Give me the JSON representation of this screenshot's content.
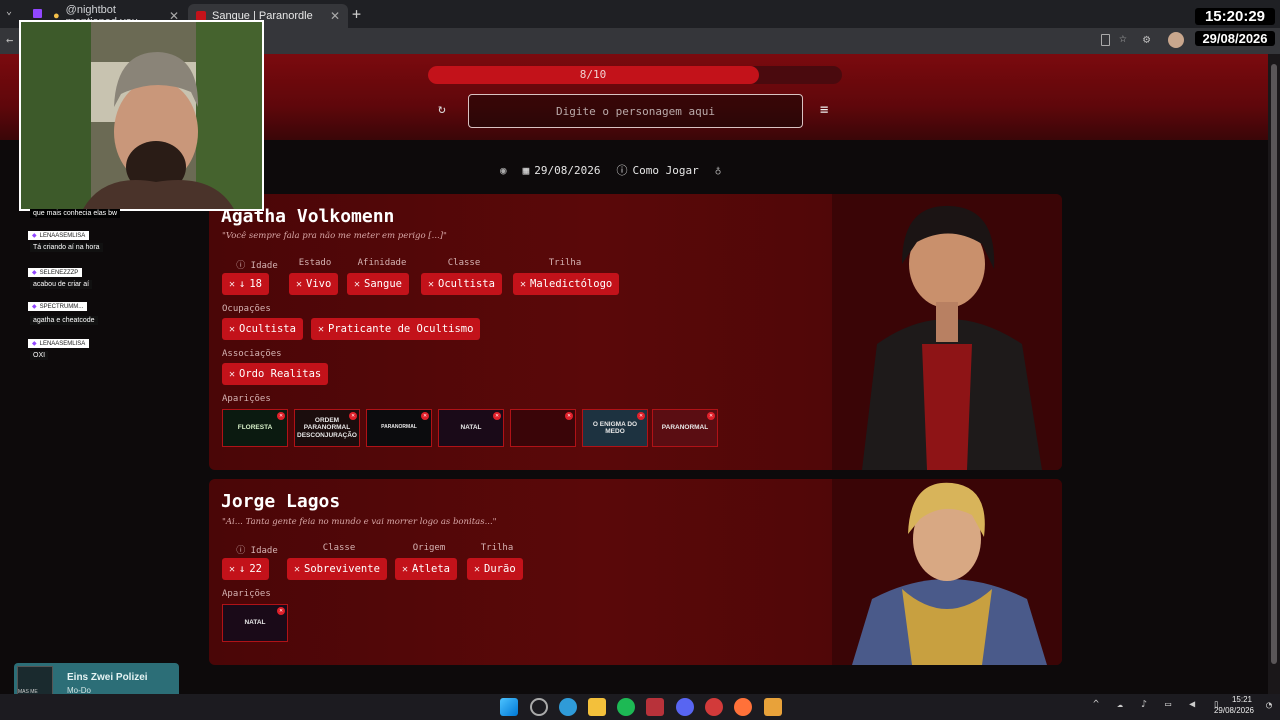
{
  "browser": {
    "tabs": [
      {
        "label": "@nightbot mentioned you",
        "active": false
      },
      {
        "label": "Sangue | Paranordle",
        "active": true
      }
    ]
  },
  "game": {
    "progress": {
      "text": "8/10",
      "fraction": 0.8
    },
    "search": {
      "placeholder": "Digite o personagem aqui"
    },
    "toolbar": {
      "date": "29/08/2026",
      "how_to_play": "Como Jogar"
    }
  },
  "cards": [
    {
      "name": "Agatha Volkomenn",
      "quote": "\"Você sempre fala pra não me meter em perigo [...]\"",
      "fields": [
        {
          "label": "Idade",
          "value": "18"
        },
        {
          "label": "Estado",
          "value": "Vivo"
        },
        {
          "label": "Afinidade",
          "value": "Sangue"
        },
        {
          "label": "Classe",
          "value": "Ocultista"
        },
        {
          "label": "Trilha",
          "value": "Maledictólogo"
        }
      ],
      "occupations_label": "Ocupações",
      "occupations": [
        "Ocultista",
        "Praticante de Ocultismo"
      ],
      "associations_label": "Associações",
      "associations": [
        "Ordo Realitas"
      ],
      "appearances_label": "Aparições",
      "appearances": [
        "FLORESTA",
        "ORDEM PARANORMAL DESCONJURAÇÃO",
        "PARANORMAL",
        "NATAL",
        "",
        "O ENIGMA DO MEDO",
        "PARANORMAL"
      ]
    },
    {
      "name": "Jorge Lagos",
      "quote": "\"Ai... Tanta gente feia no mundo e vai morrer logo as bonitas...\"",
      "fields": [
        {
          "label": "Idade",
          "value": "22"
        },
        {
          "label": "Classe",
          "value": "Sobrevivente"
        },
        {
          "label": "Origem",
          "value": "Atleta"
        },
        {
          "label": "Trilha",
          "value": "Durão"
        }
      ],
      "appearances_label": "Aparições",
      "appearances": [
        "NATAL"
      ]
    }
  ],
  "chat": [
    {
      "user": "",
      "text": "que mais conhecia elas bw"
    },
    {
      "user": "LENAASEMLISA",
      "text": "Tá criando aí na hora"
    },
    {
      "user": "SELENEZZZP",
      "text": "acabou de criar aí"
    },
    {
      "user": "SPECTRUMM...",
      "text": "agatha e cheatcode"
    },
    {
      "user": "LENAASEMLISA",
      "text": "OXI"
    }
  ],
  "stream_clock": {
    "time": "15:20:29",
    "date": "29/08/2026"
  },
  "now_playing": {
    "title": "Eins Zwei Polizei",
    "artist": "Mo-Do",
    "art": "MAS ME GASTE"
  },
  "taskbar": {
    "time": "15:21",
    "date": "29/08/2026"
  },
  "colors": {
    "accent": "#c3121a",
    "background": "#0d0a0b",
    "card": "#520708"
  }
}
